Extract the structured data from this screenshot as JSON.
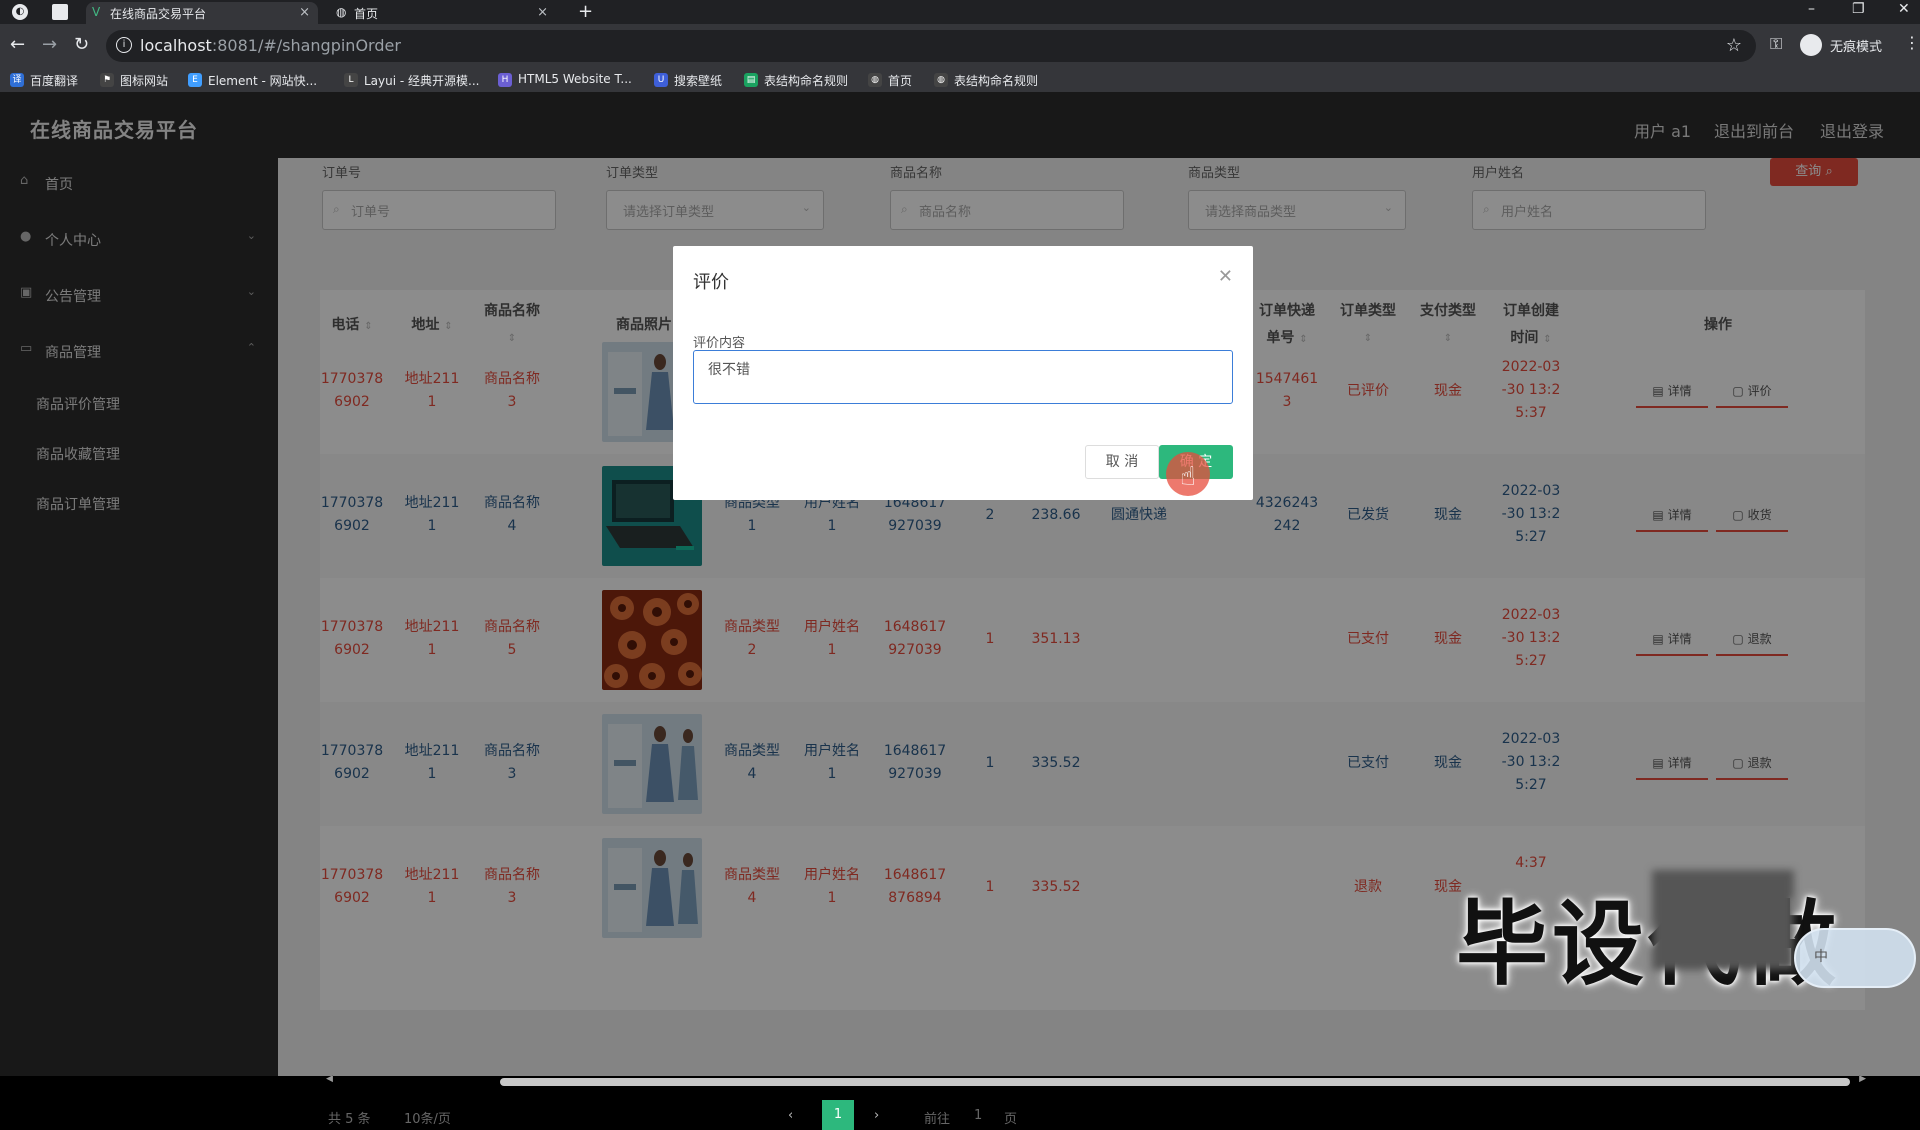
{
  "browser": {
    "tabs": [
      {
        "title": "在线商品交易平台",
        "active": true
      },
      {
        "title": "首页",
        "active": false
      }
    ],
    "url_host": "localhost",
    "url_path": ":8081/#/shangpinOrder",
    "incognito_label": "无痕模式",
    "bookmarks": [
      {
        "label": "百度翻译",
        "icon": "baidu-translate-icon",
        "color": "#2f6fd6"
      },
      {
        "label": "图标网站",
        "icon": "flag-icon",
        "color": "#444"
      },
      {
        "label": "Element - 网站快...",
        "icon": "element-icon",
        "color": "#409eff"
      },
      {
        "label": "Layui - 经典开源模...",
        "icon": "layui-icon",
        "color": "#444"
      },
      {
        "label": "HTML5 Website T...",
        "icon": "html5-icon",
        "color": "#6b5fd3"
      },
      {
        "label": "搜索壁纸",
        "icon": "wallpaper-icon",
        "color": "#3e5fd8"
      },
      {
        "label": "表结构命名规则",
        "icon": "table-icon",
        "color": "#1aa260"
      },
      {
        "label": "首页",
        "icon": "globe-icon",
        "color": "#444"
      },
      {
        "label": "表结构命名规则",
        "icon": "globe-icon",
        "color": "#444"
      }
    ]
  },
  "header": {
    "brand": "在线商品交易平台",
    "user": "用户 a1",
    "back_to_front": "退出到前台",
    "logout": "退出登录"
  },
  "sidebar": {
    "items": [
      {
        "label": "首页",
        "icon": "home-icon"
      },
      {
        "label": "个人中心",
        "icon": "user-icon"
      },
      {
        "label": "公告管理",
        "icon": "notice-icon"
      },
      {
        "label": "商品管理",
        "icon": "goods-icon"
      }
    ],
    "sub_items": [
      "商品评价管理",
      "商品收藏管理",
      "商品订单管理"
    ]
  },
  "filters": {
    "order_no": {
      "label": "订单号",
      "placeholder": "订单号"
    },
    "order_type": {
      "label": "订单类型",
      "placeholder": "请选择订单类型"
    },
    "goods_name": {
      "label": "商品名称",
      "placeholder": "商品名称"
    },
    "goods_type": {
      "label": "商品类型",
      "placeholder": "请选择商品类型"
    },
    "user_name": {
      "label": "用户姓名",
      "placeholder": "用户姓名"
    },
    "query_button": "查询"
  },
  "table": {
    "headers": {
      "phone": "电话",
      "address": "地址",
      "goods_name": "商品名称",
      "goods_photo": "商品照片",
      "express_no_1": "订单快递",
      "express_no_2": "单号",
      "order_type": "订单类型",
      "pay_type": "支付类型",
      "created_1": "订单创建",
      "created_2": "时间",
      "actions": "操作"
    },
    "rows": [
      {
        "phone1": "1770378",
        "phone2": "6902",
        "addr1": "地址211",
        "addr2": "1",
        "name1": "商品名称",
        "name2": "3",
        "type1": "",
        "type2": "",
        "user1": "",
        "user2": "",
        "no1": "",
        "no2": "",
        "qty": "",
        "price": "",
        "express": "",
        "exp1": "1547461",
        "exp2": "3",
        "otype": "已评价",
        "pay": "现金",
        "t1": "2022-03",
        "t2": "-30 13:2",
        "t3": "5:37",
        "a1": "详情",
        "a2": "评价",
        "color": "red",
        "img": "dress"
      },
      {
        "phone1": "1770378",
        "phone2": "6902",
        "addr1": "地址211",
        "addr2": "1",
        "name1": "商品名称",
        "name2": "4",
        "type1": "商品类型",
        "type2": "1",
        "user1": "用户姓名",
        "user2": "1",
        "no1": "1648617",
        "no2": "927039",
        "qty": "2",
        "price": "238.66",
        "express": "圆通快递",
        "exp1": "4326243",
        "exp2": "242",
        "otype": "已发货",
        "pay": "现金",
        "t1": "2022-03",
        "t2": "-30 13:2",
        "t3": "5:27",
        "a1": "详情",
        "a2": "收货",
        "color": "blue",
        "img": "laptop"
      },
      {
        "phone1": "1770378",
        "phone2": "6902",
        "addr1": "地址211",
        "addr2": "1",
        "name1": "商品名称",
        "name2": "5",
        "type1": "商品类型",
        "type2": "2",
        "user1": "用户姓名",
        "user2": "1",
        "no1": "1648617",
        "no2": "927039",
        "qty": "1",
        "price": "351.13",
        "express": "",
        "exp1": "",
        "exp2": "",
        "otype": "已支付",
        "pay": "现金",
        "t1": "2022-03",
        "t2": "-30 13:2",
        "t3": "5:27",
        "a1": "详情",
        "a2": "退款",
        "color": "red",
        "img": "flowers"
      },
      {
        "phone1": "1770378",
        "phone2": "6902",
        "addr1": "地址211",
        "addr2": "1",
        "name1": "商品名称",
        "name2": "3",
        "type1": "商品类型",
        "type2": "4",
        "user1": "用户姓名",
        "user2": "1",
        "no1": "1648617",
        "no2": "927039",
        "qty": "1",
        "price": "335.52",
        "express": "",
        "exp1": "",
        "exp2": "",
        "otype": "已支付",
        "pay": "现金",
        "t1": "2022-03",
        "t2": "-30 13:2",
        "t3": "5:27",
        "a1": "详情",
        "a2": "退款",
        "color": "blue",
        "img": "dress"
      },
      {
        "phone1": "1770378",
        "phone2": "6902",
        "addr1": "地址211",
        "addr2": "1",
        "name1": "商品名称",
        "name2": "3",
        "type1": "商品类型",
        "type2": "4",
        "user1": "用户姓名",
        "user2": "1",
        "no1": "1648617",
        "no2": "876894",
        "qty": "1",
        "price": "335.52",
        "express": "",
        "exp1": "",
        "exp2": "",
        "otype": "退款",
        "pay": "现金",
        "t1": "",
        "t2": "",
        "t3": "4:37",
        "a1": "",
        "a2": "",
        "color": "red",
        "img": "dress"
      }
    ]
  },
  "pagination": {
    "total": "共 5 条",
    "page_size": "10条/页",
    "current_page": "1",
    "goto_label": "前往",
    "goto_value": "1",
    "page_suffix": "页"
  },
  "modal": {
    "title": "评价",
    "field_label": "评价内容",
    "field_value": "很不错",
    "cancel": "取 消",
    "confirm": "确 定"
  },
  "watermark": {
    "text": "毕设代做",
    "ime_char": "中"
  },
  "colors": {
    "accent_red": "#e74c3c",
    "accent_green": "#2db87d",
    "link_blue": "#2f5d8a"
  }
}
